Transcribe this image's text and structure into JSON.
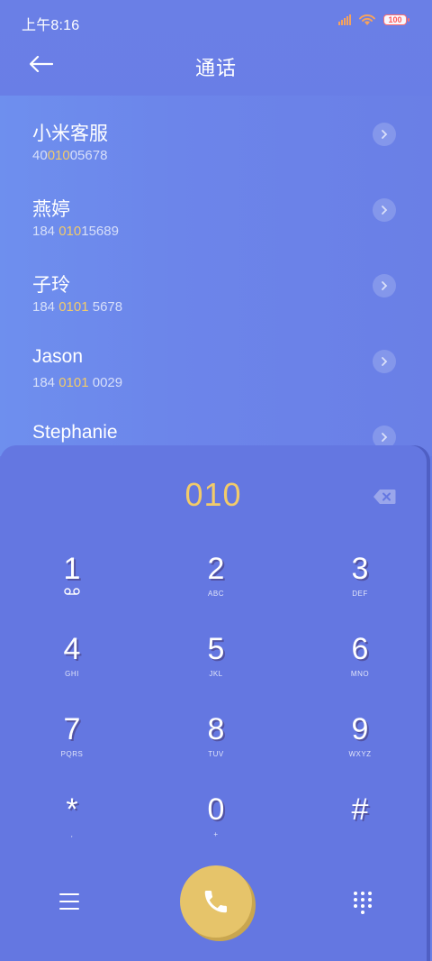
{
  "status_bar": {
    "time": "上午8:16",
    "battery": "100"
  },
  "header": {
    "title": "通话"
  },
  "contacts": [
    {
      "name": "小米客服",
      "number_parts": [
        "40",
        "010",
        "05678"
      ]
    },
    {
      "name": "燕婷",
      "number_parts": [
        "184 ",
        "010",
        "15689"
      ]
    },
    {
      "name": "子玲",
      "number_parts": [
        "184 ",
        "0101",
        " 5678"
      ]
    },
    {
      "name": "Jason",
      "number_parts": [
        "184 ",
        "0101",
        " 0029"
      ]
    },
    {
      "name": "Stephanie",
      "number_parts": [
        "",
        "",
        ""
      ]
    }
  ],
  "dialpad": {
    "display": "010",
    "keys": [
      {
        "digit": "1",
        "letters": ""
      },
      {
        "digit": "2",
        "letters": "ABC"
      },
      {
        "digit": "3",
        "letters": "DEF"
      },
      {
        "digit": "4",
        "letters": "GHI"
      },
      {
        "digit": "5",
        "letters": "JKL"
      },
      {
        "digit": "6",
        "letters": "MNO"
      },
      {
        "digit": "7",
        "letters": "PQRS"
      },
      {
        "digit": "8",
        "letters": "TUV"
      },
      {
        "digit": "9",
        "letters": "WXYZ"
      },
      {
        "digit": "*",
        "letters": ","
      },
      {
        "digit": "0",
        "letters": "+"
      },
      {
        "digit": "#",
        "letters": ""
      }
    ]
  },
  "icons": {
    "back": "arrow-left-icon",
    "detail": "chevron-right-icon",
    "backspace": "backspace-icon",
    "voicemail": "voicemail-icon",
    "menu": "menu-icon",
    "call": "phone-icon",
    "dialpad_toggle": "dialpad-grid-icon"
  },
  "colors": {
    "background": "#6a7fe6",
    "panel": "#6477e1",
    "highlight": "#f2cb6a",
    "call_button": "#e6c46a"
  }
}
